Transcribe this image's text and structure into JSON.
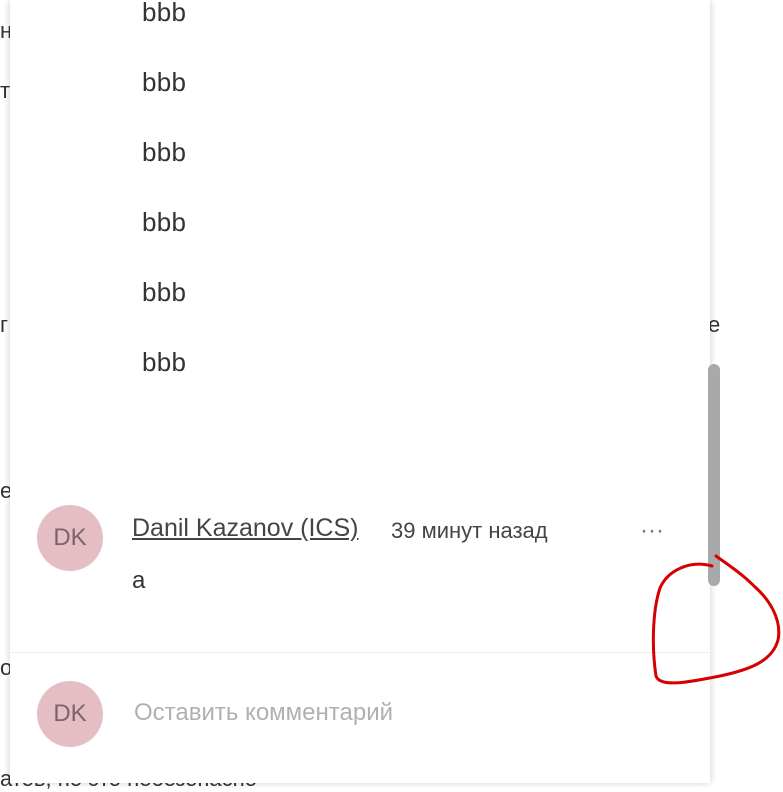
{
  "background": {
    "fragments": [
      "н",
      "т",
      "г",
      "е",
      "е",
      "о"
    ],
    "bottom_text": "атов, но это небезопасно"
  },
  "content": {
    "lines": [
      "bbb",
      "bbb",
      "bbb",
      "bbb",
      "bbb",
      "bbb"
    ]
  },
  "comment": {
    "avatar_initials": "DK",
    "author": "Danil Kazanov (ICS)",
    "time": "39 минут назад",
    "text": "a",
    "more": "···"
  },
  "composer": {
    "avatar_initials": "DK",
    "placeholder": "Оставить комментарий",
    "value": ""
  },
  "colors": {
    "avatar_bg": "#e5bec5",
    "scrollbar": "#a9a9a9",
    "annotation": "#d60000"
  }
}
